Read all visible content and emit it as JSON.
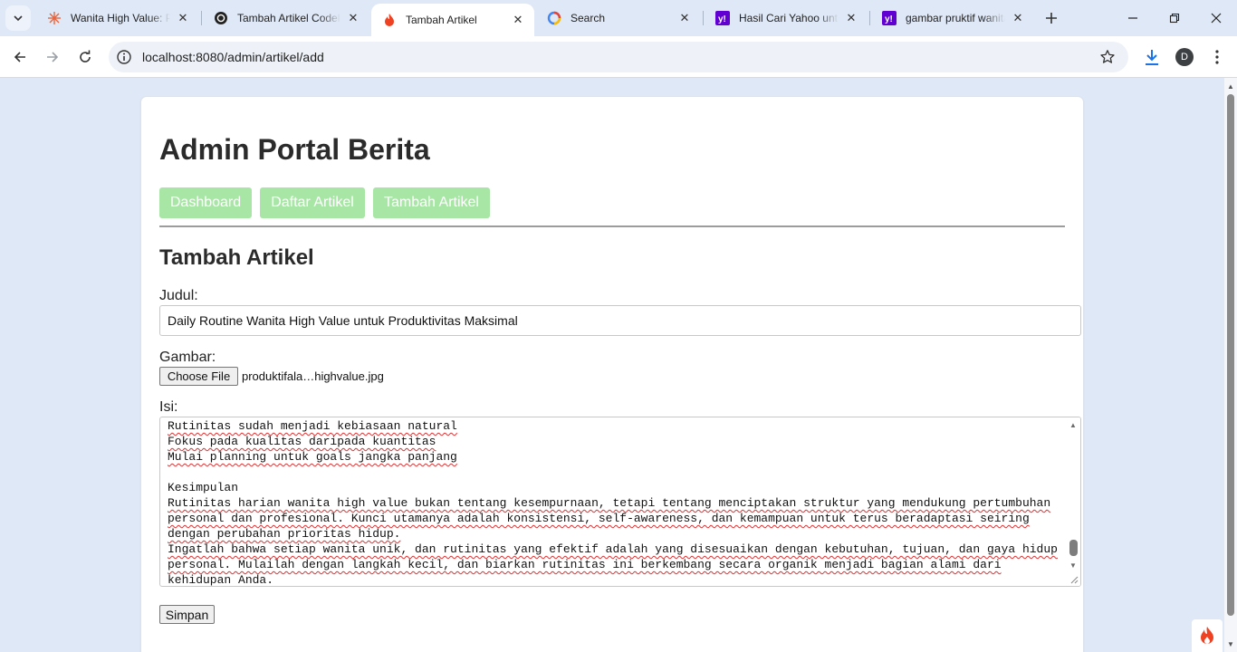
{
  "browser": {
    "tabs": [
      {
        "title": "Wanita High Value: Pa",
        "icon": "sunburst-favicon-icon",
        "active": false
      },
      {
        "title": "Tambah Artikel Codel",
        "icon": "openai-favicon-icon",
        "active": false
      },
      {
        "title": "Tambah Artikel",
        "icon": "flame-favicon-icon",
        "active": true
      },
      {
        "title": "Search",
        "icon": "google-circle-favicon-icon",
        "active": false
      },
      {
        "title": "Hasil Cari Yahoo untu",
        "icon": "yahoo-favicon-icon",
        "active": false
      },
      {
        "title": "gambar pruktif wanita",
        "icon": "yahoo-favicon-icon",
        "active": false
      }
    ],
    "url": "localhost:8080/admin/artikel/add",
    "profile_initial": "D"
  },
  "page": {
    "title": "Admin Portal Berita",
    "nav": {
      "dashboard": "Dashboard",
      "daftar": "Daftar Artikel",
      "tambah": "Tambah Artikel"
    },
    "section_title": "Tambah Artikel",
    "form": {
      "judul_label": "Judul:",
      "judul_value": "Daily Routine Wanita High Value untuk Produktivitas Maksimal",
      "gambar_label": "Gambar:",
      "file_button": "Choose File",
      "file_name": "produktifala…highvalue.jpg",
      "isi_label": "Isi:",
      "isi_lines": [
        "Rutinitas sudah menjadi kebiasaan natural",
        "Fokus pada kualitas daripada kuantitas",
        "Mulai planning untuk goals jangka panjang",
        "",
        "Kesimpulan",
        "Rutinitas harian wanita high value bukan tentang kesempurnaan, tetapi tentang menciptakan struktur yang mendukung pertumbuhan",
        "personal dan profesional. Kunci utamanya adalah konsistensi, self-awareness, dan kemampuan untuk terus beradaptasi seiring",
        "dengan perubahan prioritas hidup.",
        "Ingatlah bahwa setiap wanita unik, dan rutinitas yang efektif adalah yang disesuaikan dengan kebutuhan, tujuan, dan gaya hidup",
        "personal. Mulailah dengan langkah kecil, dan biarkan rutinitas ini berkembang secara organik menjadi bagian alami dari",
        "kehidupan Anda."
      ],
      "submit": "Simpan"
    }
  },
  "colors": {
    "nav_button_bg": "#a8e6a6",
    "chrome_bg": "#dfe8f6",
    "download_icon": "#1a73e8",
    "spellcheck": "#e03030"
  }
}
